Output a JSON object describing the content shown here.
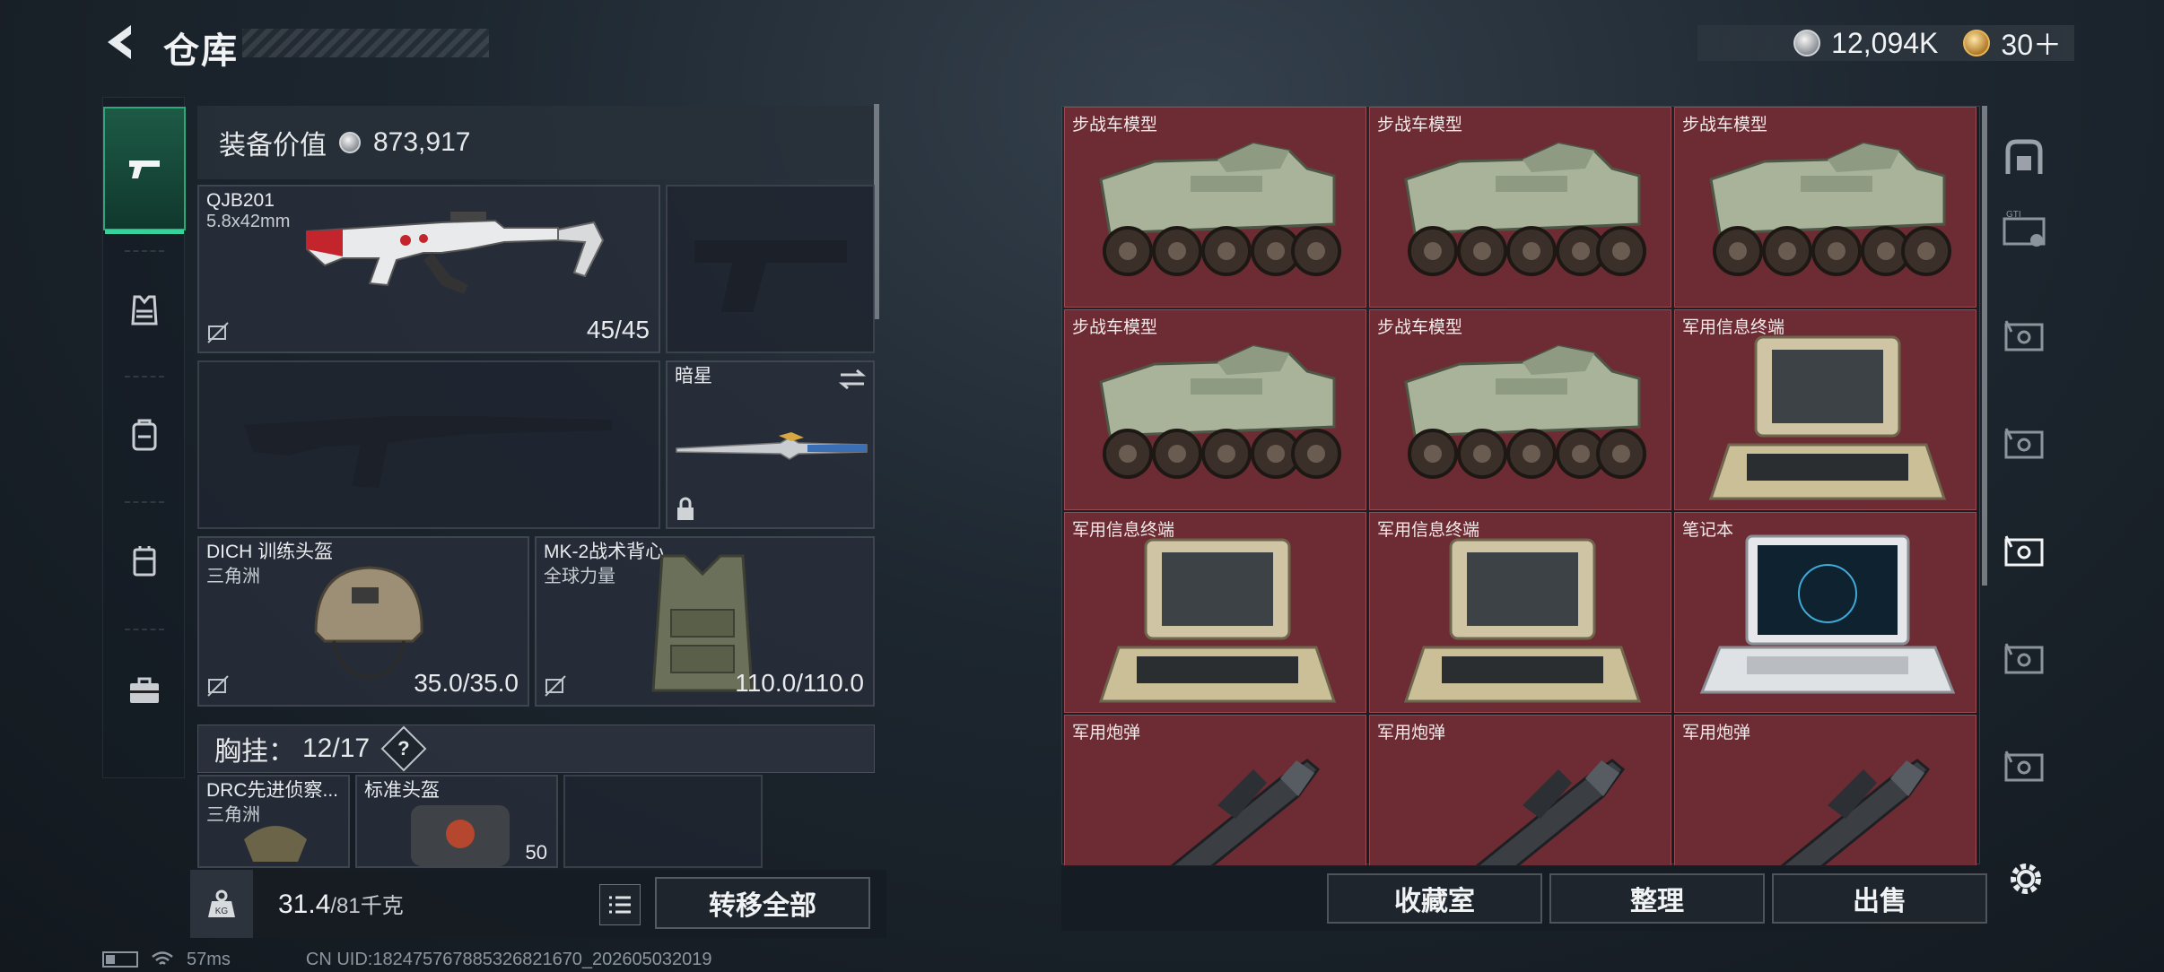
{
  "header": {
    "title": "仓库",
    "silver_amount": "12,094K",
    "gold_amount": "30＋"
  },
  "equipment": {
    "value_label": "装备价值",
    "value": "873,917",
    "primary": {
      "name": "QJB201",
      "caliber": "5.8x42mm",
      "ammo": "45/45"
    },
    "melee": {
      "name": "暗星"
    },
    "helmet": {
      "name": "DICH 训练头盔",
      "faction": "三角洲",
      "durability": "35.0/35.0"
    },
    "armor": {
      "name": "MK-2战术背心",
      "faction": "全球力量",
      "durability": "110.0/110.0"
    },
    "chest_label": "胸挂：",
    "chest_value": "12/17",
    "chest_help": "?",
    "backpack1": {
      "name": "DRC先进侦察...",
      "faction": "三角洲"
    },
    "backpack2": {
      "name": "标准头盔",
      "extra": "50"
    }
  },
  "weight": {
    "value": "31.4",
    "max": "/81千克",
    "icon": "KG"
  },
  "actions": {
    "transfer_all": "转移全部",
    "collection": "收藏室",
    "sort": "整理",
    "sell": "出售"
  },
  "loot": [
    {
      "label": "步战车模型",
      "icon": "ifv-model"
    },
    {
      "label": "步战车模型",
      "icon": "ifv-model"
    },
    {
      "label": "步战车模型",
      "icon": "ifv-model"
    },
    {
      "label": "步战车模型",
      "icon": "ifv-model"
    },
    {
      "label": "步战车模型",
      "icon": "ifv-model"
    },
    {
      "label": "军用信息终端",
      "icon": "military-terminal"
    },
    {
      "label": "军用信息终端",
      "icon": "military-terminal"
    },
    {
      "label": "军用信息终端",
      "icon": "military-terminal"
    },
    {
      "label": "笔记本",
      "icon": "laptop"
    },
    {
      "label": "军用炮弹",
      "icon": "artillery-shell"
    },
    {
      "label": "军用炮弹",
      "icon": "artillery-shell"
    },
    {
      "label": "军用炮弹",
      "icon": "artillery-shell"
    }
  ],
  "status": {
    "ping": "57ms",
    "uid": "CN UID:182475767885326821670_202605032019"
  },
  "colors": {
    "accent_green": "#2ea87a",
    "loot_cell": "#6d2c33",
    "panel": "#28303a"
  }
}
